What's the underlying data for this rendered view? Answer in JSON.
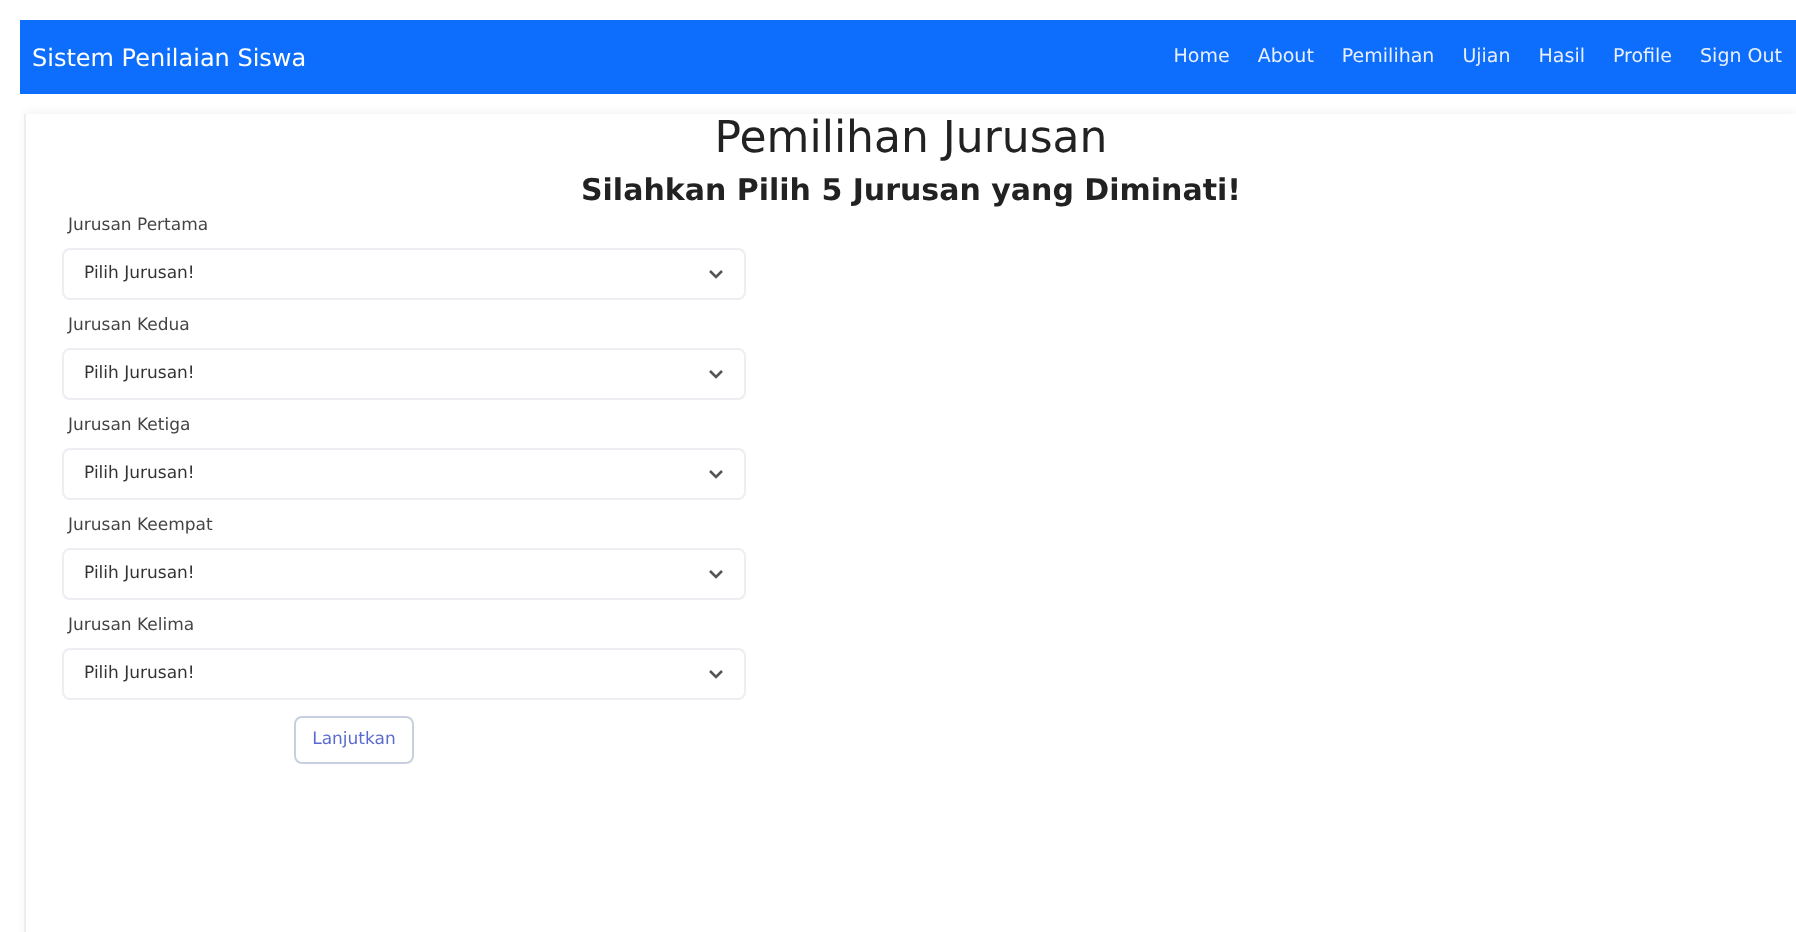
{
  "navbar": {
    "brand": "Sistem Penilaian Siswa",
    "links": [
      "Home",
      "About",
      "Pemilihan",
      "Ujian",
      "Hasil",
      "Profile",
      "Sign Out"
    ]
  },
  "title": "Pemilihan Jurusan",
  "subtitle": "Silahkan Pilih 5 Jurusan yang Diminati!",
  "fields": [
    {
      "label": "Jurusan Pertama",
      "value": "Pilih Jurusan!"
    },
    {
      "label": "Jurusan Kedua",
      "value": "Pilih Jurusan!"
    },
    {
      "label": "Jurusan Ketiga",
      "value": "Pilih Jurusan!"
    },
    {
      "label": "Jurusan Keempat",
      "value": "Pilih Jurusan!"
    },
    {
      "label": "Jurusan Kelima",
      "value": "Pilih Jurusan!"
    }
  ],
  "button": "Lanjutkan"
}
